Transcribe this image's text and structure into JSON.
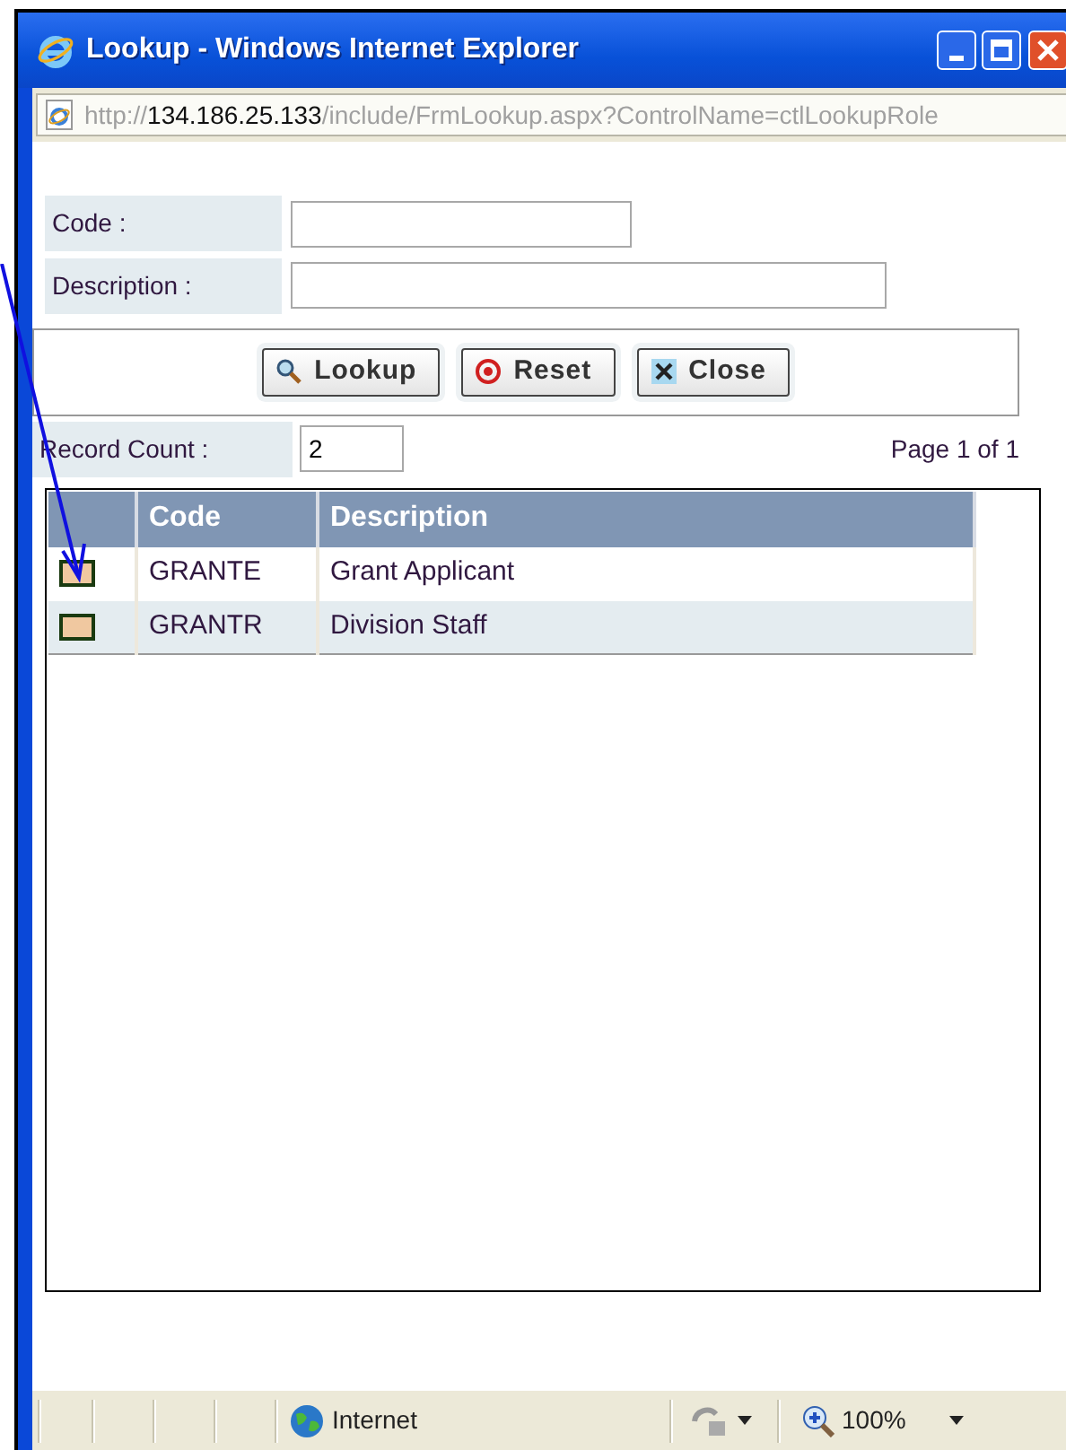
{
  "window": {
    "title": "Lookup - Windows Internet Explorer"
  },
  "address_bar": {
    "url_scheme": "http://",
    "url_host": "134.186.25.133",
    "url_path": "/include/FrmLookup.aspx?ControlName=ctlLookupRole"
  },
  "form": {
    "fields": [
      {
        "label": "Code :"
      },
      {
        "label": "Description :"
      }
    ]
  },
  "buttons": [
    {
      "label": "Lookup",
      "kind": "search"
    },
    {
      "label": "Reset",
      "kind": "reset"
    },
    {
      "label": "Close",
      "kind": "close"
    }
  ],
  "record_count": {
    "label": "Record Count :",
    "value": "2"
  },
  "pager": "Page 1 of 1",
  "table": {
    "columns": [
      "Code",
      "Description"
    ],
    "rows": [
      {
        "code": "GRANTE",
        "description": "Grant Applicant"
      },
      {
        "code": "GRANTR",
        "description": "Division Staff"
      }
    ]
  },
  "status_bar": {
    "zone": "Internet",
    "zoom": "100%"
  }
}
